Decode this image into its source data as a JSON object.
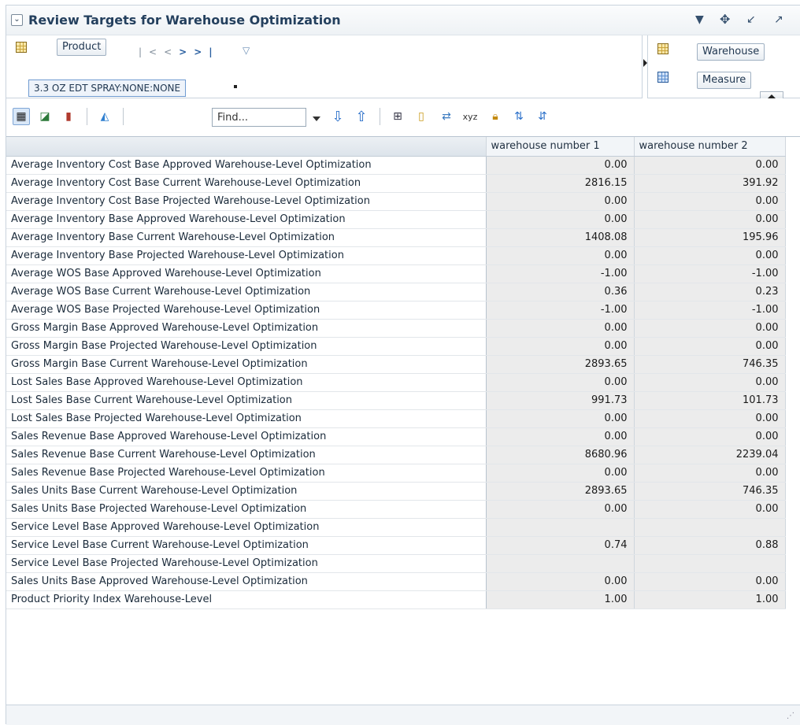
{
  "header": {
    "title": "Review Targets for Warehouse Optimization",
    "collapse_glyph": "⌄",
    "icons": [
      "dropdown-icon",
      "move-icon",
      "restore-icon",
      "maximize-icon"
    ]
  },
  "pivot": {
    "product_label": "Product",
    "current_member": "3.3 OZ EDT SPRAY:NONE:NONE",
    "warehouse_label": "Warehouse",
    "measure_label": "Measure"
  },
  "toolbar": {
    "find_placeholder": "Find..."
  },
  "table": {
    "columns": [
      "warehouse number 1",
      "warehouse number 2"
    ],
    "rows": [
      {
        "label": "Average Inventory Cost Base Approved Warehouse-Level Optimization",
        "v1": "0.00",
        "v2": "0.00"
      },
      {
        "label": "Average Inventory Cost Base Current Warehouse-Level Optimization",
        "v1": "2816.15",
        "v2": "391.92"
      },
      {
        "label": "Average Inventory Cost Base Projected Warehouse-Level Optimization",
        "v1": "0.00",
        "v2": "0.00"
      },
      {
        "label": "Average Inventory Base Approved Warehouse-Level Optimization",
        "v1": "0.00",
        "v2": "0.00"
      },
      {
        "label": "Average Inventory Base Current Warehouse-Level Optimization",
        "v1": "1408.08",
        "v2": "195.96"
      },
      {
        "label": "Average Inventory Base Projected Warehouse-Level Optimization",
        "v1": "0.00",
        "v2": "0.00"
      },
      {
        "label": "Average WOS Base Approved Warehouse-Level Optimization",
        "v1": "-1.00",
        "v2": "-1.00"
      },
      {
        "label": "Average WOS Base Current Warehouse-Level Optimization",
        "v1": "0.36",
        "v2": "0.23"
      },
      {
        "label": "Average WOS Base Projected Warehouse-Level Optimization",
        "v1": "-1.00",
        "v2": "-1.00"
      },
      {
        "label": "Gross Margin Base Approved Warehouse-Level Optimization",
        "v1": "0.00",
        "v2": "0.00"
      },
      {
        "label": "Gross Margin Base Projected Warehouse-Level Optimization",
        "v1": "0.00",
        "v2": "0.00"
      },
      {
        "label": "Gross Margin Base Current Warehouse-Level Optimization",
        "v1": "2893.65",
        "v2": "746.35"
      },
      {
        "label": "Lost Sales Base Approved Warehouse-Level Optimization",
        "v1": "0.00",
        "v2": "0.00"
      },
      {
        "label": "Lost Sales Base Current Warehouse-Level Optimization",
        "v1": "991.73",
        "v2": "101.73"
      },
      {
        "label": "Lost Sales Base Projected Warehouse-Level Optimization",
        "v1": "0.00",
        "v2": "0.00"
      },
      {
        "label": "Sales Revenue Base Approved Warehouse-Level Optimization",
        "v1": "0.00",
        "v2": "0.00"
      },
      {
        "label": "Sales Revenue Base Current Warehouse-Level Optimization",
        "v1": "8680.96",
        "v2": "2239.04"
      },
      {
        "label": "Sales Revenue Base Projected Warehouse-Level Optimization",
        "v1": "0.00",
        "v2": "0.00"
      },
      {
        "label": "Sales Units Base Current Warehouse-Level Optimization",
        "v1": "2893.65",
        "v2": "746.35"
      },
      {
        "label": "Sales Units Base Projected Warehouse-Level Optimization",
        "v1": "0.00",
        "v2": "0.00"
      },
      {
        "label": "Service Level Base Approved Warehouse-Level Optimization",
        "v1": "",
        "v2": ""
      },
      {
        "label": "Service Level Base Current Warehouse-Level Optimization",
        "v1": "0.74",
        "v2": "0.88"
      },
      {
        "label": "Service Level Base Projected Warehouse-Level Optimization",
        "v1": "",
        "v2": ""
      },
      {
        "label": "Sales Units Base Approved Warehouse-Level Optimization",
        "v1": "0.00",
        "v2": "0.00"
      },
      {
        "label": "Product Priority Index Warehouse-Level",
        "v1": "1.00",
        "v2": "1.00"
      }
    ]
  }
}
